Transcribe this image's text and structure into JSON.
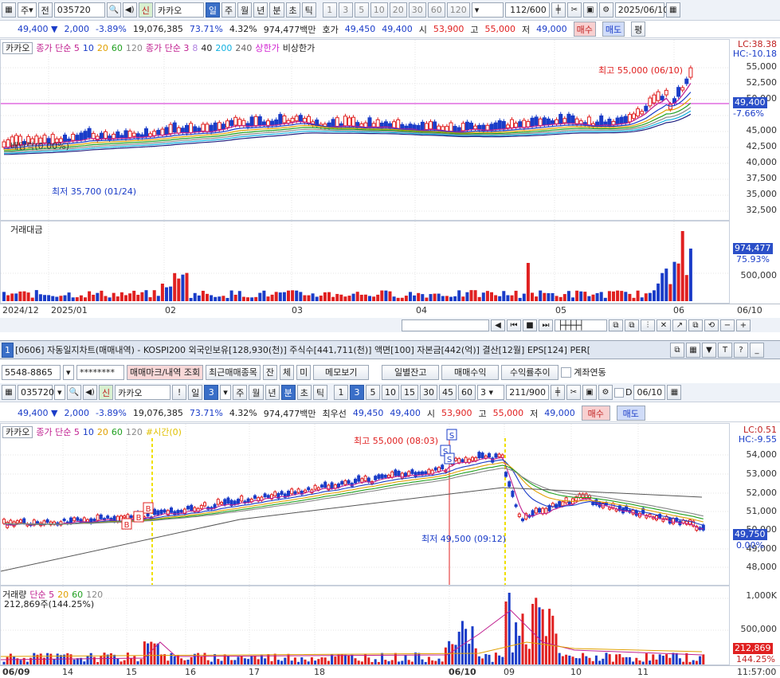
{
  "top_toolbar": {
    "market": "주",
    "prev": "전",
    "code": "035720",
    "credit_badge": "신",
    "name": "카카오",
    "periods": [
      "일",
      "주",
      "월",
      "년",
      "분",
      "초",
      "틱"
    ],
    "active_period": "일",
    "minute_options": [
      "1",
      "3",
      "5",
      "10",
      "20",
      "30",
      "60",
      "120"
    ],
    "count": "112/600",
    "date": "2025/06/10"
  },
  "top_quote": {
    "price": "49,400 ▼",
    "change": "2,000",
    "rate": "-3.89%",
    "volume": "19,076,385",
    "vol_ratio": "73.71%",
    "turnover": "4.32%",
    "amount": "974,477백만",
    "hoga_label": "호가",
    "bid": "49,450",
    "ask": "49,400",
    "open_label": "시",
    "open": "53,900",
    "high_label": "고",
    "high": "55,000",
    "low_label": "저",
    "low": "49,000",
    "buy": "매수",
    "sell": "매도",
    "eval": "평"
  },
  "daily_chart": {
    "legend": {
      "name": "카카오",
      "ma_a": "종가 단순 5",
      "ma_a_vals": [
        "10",
        "20",
        "60",
        "120"
      ],
      "ma_b": "종가 단순 3",
      "ma_b_vals": [
        "8",
        "40",
        "200",
        "240"
      ],
      "upper": "상한가",
      "lower": "비상한가"
    },
    "yticks": [
      "55,000",
      "52,500",
      "50,000",
      "47,500",
      "45,000",
      "42,500",
      "40,000",
      "37,500",
      "35,000",
      "32,500"
    ],
    "lc": "LC:38.38",
    "hc": "HC:-10.18",
    "price_tag": "49,400",
    "price_pct": "-7.66%",
    "high_note": "최고 55,000 (06/10)",
    "low_note": "최저 35,700 (01/24)",
    "div_note": "배당락(0.00%)",
    "volume_title": "거래대금",
    "vol_tag": "974,477",
    "vol_pct": "75.93%",
    "vol_tick": "500,000",
    "xticks": [
      "2024/12",
      "2025/01",
      "02",
      "03",
      "04",
      "05",
      "06"
    ],
    "xend": "06/10"
  },
  "window2": {
    "index": "1",
    "title": "[0606] 자동일지차트(매매내역) - KOSPI200 외국인보유[128,930(천)] 주식수[441,711(천)] 액면[100] 자본금[442(억)] 결산[12월] EPS[124] PER[",
    "account": "5548-8865",
    "password": "********",
    "buttons": [
      "매매마크/내역 조회",
      "최근매매종목",
      "잔",
      "체",
      "미",
      "메모보기",
      "일별잔고",
      "매매수익",
      "수익률추이"
    ],
    "link_label": "계좌연동"
  },
  "toolbar2": {
    "code": "035720",
    "credit_badge": "신",
    "name": "카카오",
    "periods": [
      "일",
      "3",
      "주",
      "월",
      "년",
      "분",
      "초",
      "틱"
    ],
    "active_period": "분",
    "minute_options": [
      "1",
      "3",
      "5",
      "10",
      "15",
      "30",
      "45",
      "60"
    ],
    "active_minute": "3",
    "interval": "3",
    "count": "211/900",
    "d_label": "D",
    "date": "06/10"
  },
  "quote2": {
    "price": "49,400 ▼",
    "change": "2,000",
    "rate": "-3.89%",
    "volume": "19,076,385",
    "vol_ratio": "73.71%",
    "turnover": "4.32%",
    "amount": "974,477백만",
    "best_label": "최우선",
    "bid": "49,450",
    "ask": "49,400",
    "open_label": "시",
    "open": "53,900",
    "high_label": "고",
    "high": "55,000",
    "low_label": "저",
    "low": "49,000",
    "buy": "매수",
    "sell": "매도"
  },
  "minute_chart": {
    "legend": {
      "name": "카카오",
      "ma": "종가 단순 5",
      "ma_vals": [
        "10",
        "20",
        "60",
        "120"
      ],
      "extra": "#시간(0)"
    },
    "yticks": [
      "54,000",
      "53,000",
      "52,000",
      "51,000",
      "50,000",
      "49,000",
      "48,000"
    ],
    "lc": "LC:0.51",
    "hc": "HC:-9.55",
    "price_tag": "49,750",
    "price_pct": "0.00%",
    "high_note": "최고 55,000 (08:03)",
    "low_note": "최저 49,500 (09:12)",
    "volume_legend": {
      "title": "거래량",
      "ma": "단순 5",
      "vals": [
        "20",
        "60",
        "120"
      ]
    },
    "vol_value": "212,869주(144.25%)",
    "vol_ticks": [
      "1,000K",
      "500,000"
    ],
    "vol_tag": "212,869",
    "vol_pct": "144.25%",
    "xticks": [
      "06/09",
      "14",
      "15",
      "16",
      "17",
      "18",
      "06/10",
      "09",
      "10",
      "11"
    ],
    "time": "11:57:00"
  },
  "colors": {
    "up": "#e02020",
    "down": "#1a3cc8",
    "bg": "#eef2f8"
  }
}
